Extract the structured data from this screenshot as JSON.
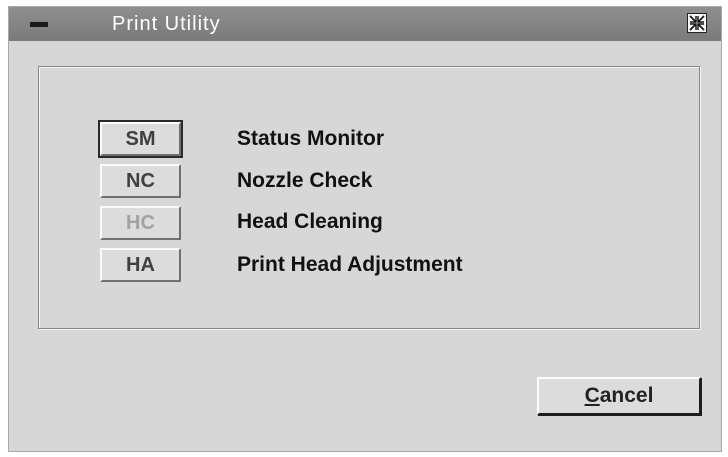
{
  "window": {
    "title": "Print Utility"
  },
  "utilities": [
    {
      "code": "SM",
      "label": "Status Monitor",
      "state": "focused"
    },
    {
      "code": "NC",
      "label": "Nozzle Check",
      "state": "normal"
    },
    {
      "code": "HC",
      "label": "Head Cleaning",
      "state": "disabled"
    },
    {
      "code": "HA",
      "label": "Print Head Adjustment",
      "state": "normal"
    }
  ],
  "footer": {
    "cancel_mnemonic": "C",
    "cancel_rest": "ancel"
  },
  "icons": {
    "window_menu": "window-menu-icon",
    "maximize": "maximize-icon"
  },
  "colors": {
    "titlebar": "#808080",
    "dialog_bg": "#d7d7d7",
    "disabled_text": "#a2a2a2"
  }
}
